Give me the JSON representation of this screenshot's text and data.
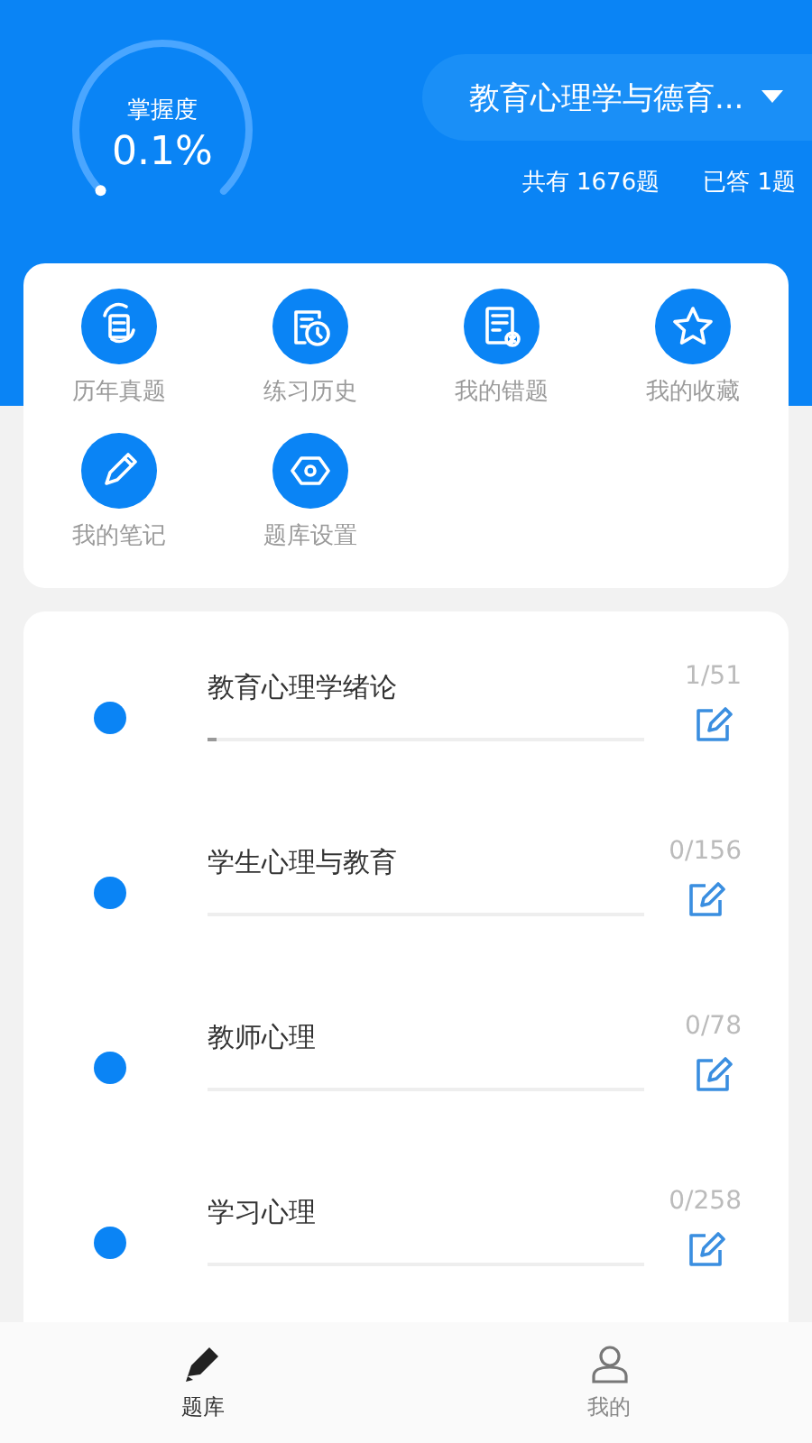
{
  "mastery": {
    "label": "掌握度",
    "value": "0.1%"
  },
  "subject_dropdown": {
    "value": "教育心理学与德育..."
  },
  "stats": [
    "共有 1676题",
    "已答 1题"
  ],
  "shortcuts": [
    {
      "kind": "real",
      "label": "历年真题"
    },
    {
      "kind": "history",
      "label": "练习历史"
    },
    {
      "kind": "wrong",
      "label": "我的错题"
    },
    {
      "kind": "favorite",
      "label": "我的收藏"
    },
    {
      "kind": "notes",
      "label": "我的笔记"
    },
    {
      "kind": "settings",
      "label": "题库设置"
    }
  ],
  "chapters": [
    {
      "title": "教育心理学绪论",
      "count": "1/51",
      "level": 0.02
    },
    {
      "title": "学生心理与教育",
      "count": "0/156"
    },
    {
      "title": "教师心理",
      "count": "0/78"
    },
    {
      "title": "学习心理",
      "count": "0/258"
    }
  ],
  "tabs": [
    {
      "kind": "bank",
      "label": "题库",
      "selected": true
    },
    {
      "kind": "me",
      "label": "我的",
      "selected": false
    }
  ]
}
